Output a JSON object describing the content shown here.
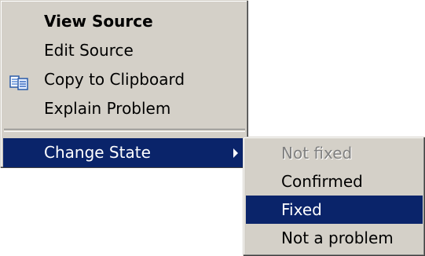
{
  "context_menu": {
    "items": [
      {
        "label": "View Source",
        "bold": true
      },
      {
        "label": "Edit Source"
      },
      {
        "label": "Copy to Clipboard",
        "icon": "copy-clipboard-icon"
      },
      {
        "label": "Explain Problem"
      },
      {
        "label": "Change State",
        "has_submenu": true,
        "highlighted": true
      }
    ]
  },
  "submenu": {
    "items": [
      {
        "label": "Not fixed",
        "disabled": true
      },
      {
        "label": "Confirmed"
      },
      {
        "label": "Fixed",
        "highlighted": true
      },
      {
        "label": "Not a problem"
      }
    ]
  },
  "colors": {
    "menu_bg": "#d4d0c8",
    "highlight": "#0a246a",
    "disabled_text": "#808080"
  }
}
